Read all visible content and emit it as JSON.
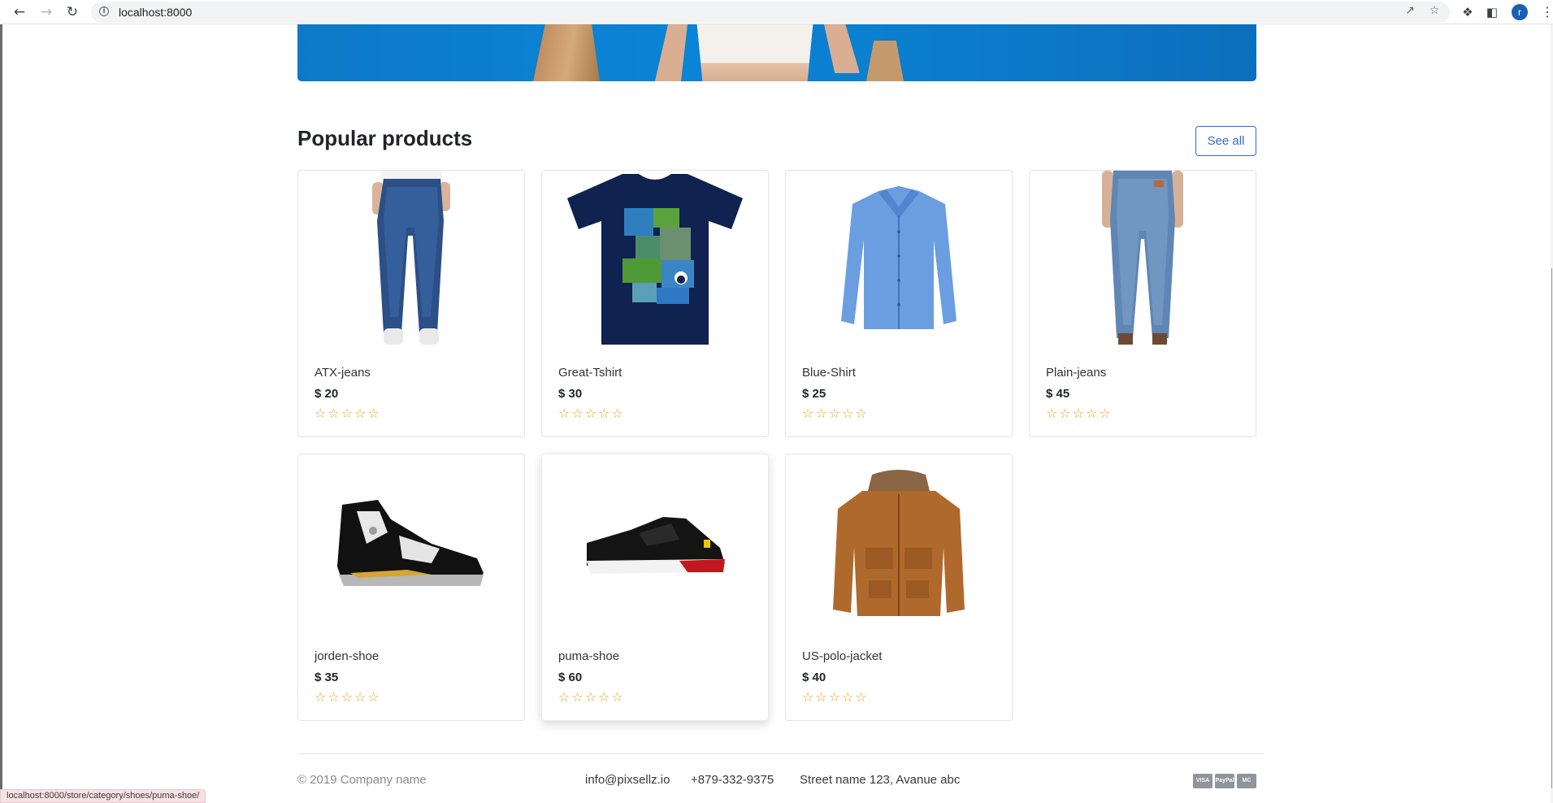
{
  "browser": {
    "url": "localhost:8000",
    "profile_initial": "r",
    "nav_icons": [
      "back-arrow-icon",
      "forward-arrow-icon",
      "reload-icon"
    ],
    "status_url": "localhost:8000/store/category/shoes/puma-shoe/"
  },
  "section": {
    "title": "Popular products",
    "see_all_label": "See all"
  },
  "products": [
    {
      "name": "ATX-jeans",
      "price": "$ 20",
      "rating": "☆☆☆☆☆",
      "image": "jeans-dark"
    },
    {
      "name": "Great-Tshirt",
      "price": "$ 30",
      "rating": "☆☆☆☆☆",
      "image": "tshirt-navy"
    },
    {
      "name": "Blue-Shirt",
      "price": "$ 25",
      "rating": "☆☆☆☆☆",
      "image": "shirt-blue"
    },
    {
      "name": "Plain-jeans",
      "price": "$ 45",
      "rating": "☆☆☆☆☆",
      "image": "jeans-light"
    },
    {
      "name": "jorden-shoe",
      "price": "$ 35",
      "rating": "☆☆☆☆☆",
      "image": "sneaker-black-white"
    },
    {
      "name": "puma-shoe",
      "price": "$ 60",
      "rating": "☆☆☆☆☆",
      "image": "sneaker-black"
    },
    {
      "name": "US-polo-jacket",
      "price": "$ 40",
      "rating": "☆☆☆☆☆",
      "image": "jacket-brown"
    }
  ],
  "footer": {
    "copyright": "© 2019 Company name",
    "email": "info@pixsellz.io",
    "phone": "+879-332-9375",
    "address": "Street name 123, Avanue abc",
    "payment_icons": [
      "visa-icon",
      "paypal-icon",
      "mastercard-icon"
    ],
    "payment_labels": [
      "VISA",
      "PayPal",
      "MC"
    ]
  },
  "colors": {
    "accent": "#3167eb",
    "star": "#f0a020",
    "banner": "#0b7fd0"
  }
}
